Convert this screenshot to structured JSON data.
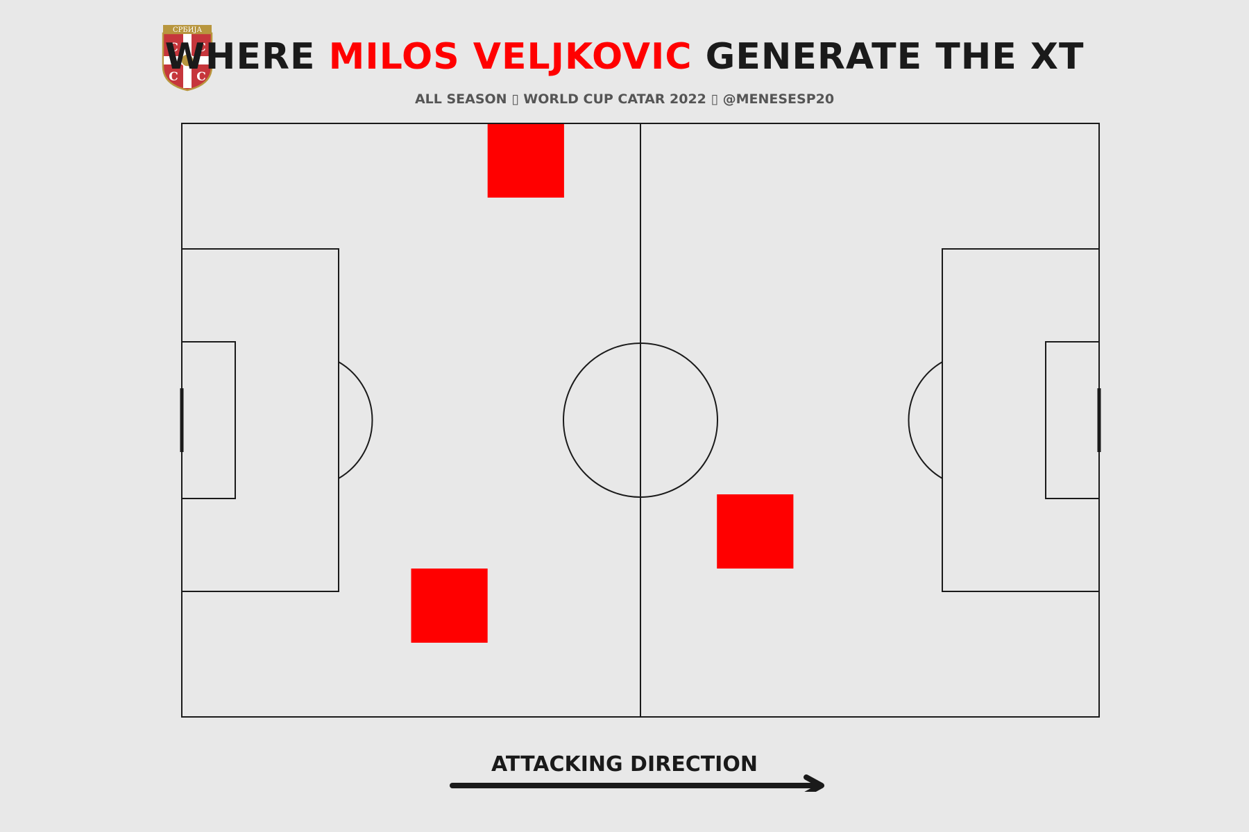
{
  "header": {
    "title_prefix": "WHERE ",
    "title_highlight": "MILOS VELJKOVIC",
    "title_suffix": " GENERATE THE XT",
    "subtitle": "ALL SEASON ▯ WORLD CUP CATAR 2022 ▯ @MENESESP20",
    "crest_text": "СРБИЈА"
  },
  "footer": {
    "direction_label": "ATTACKING DIRECTION"
  },
  "colors": {
    "background": "#e8e8e8",
    "accent": "#ff0000",
    "lines": "#1a1a1a",
    "crest_red": "#c6363c",
    "crest_gold": "#b8963e"
  },
  "chart_data": {
    "type": "heatmap",
    "pitch": {
      "length": 120,
      "width": 80,
      "orientation": "horizontal"
    },
    "bins": {
      "columns": 12,
      "rows": 8
    },
    "highlighted_bins": [
      {
        "column": 4,
        "row": 0,
        "value": 1
      },
      {
        "column": 3,
        "row": 6,
        "value": 1
      },
      {
        "column": 7,
        "row": 5,
        "value": 1
      }
    ],
    "colormap": [
      "#e8e8e8",
      "#ff0000"
    ]
  }
}
